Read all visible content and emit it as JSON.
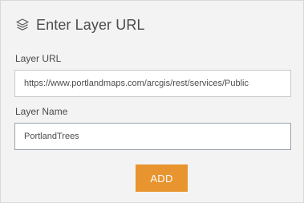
{
  "panel": {
    "title": "Enter Layer URL",
    "title_icon": "layers-icon"
  },
  "form": {
    "url_label": "Layer URL",
    "url_value": "https://www.portlandmaps.com/arcgis/rest/services/Public",
    "name_label": "Layer Name",
    "name_value": "PortlandTrees"
  },
  "actions": {
    "add_label": "ADD"
  },
  "colors": {
    "accent": "#e8942f",
    "background": "#f3f3f3",
    "text": "#4c4c4c"
  }
}
